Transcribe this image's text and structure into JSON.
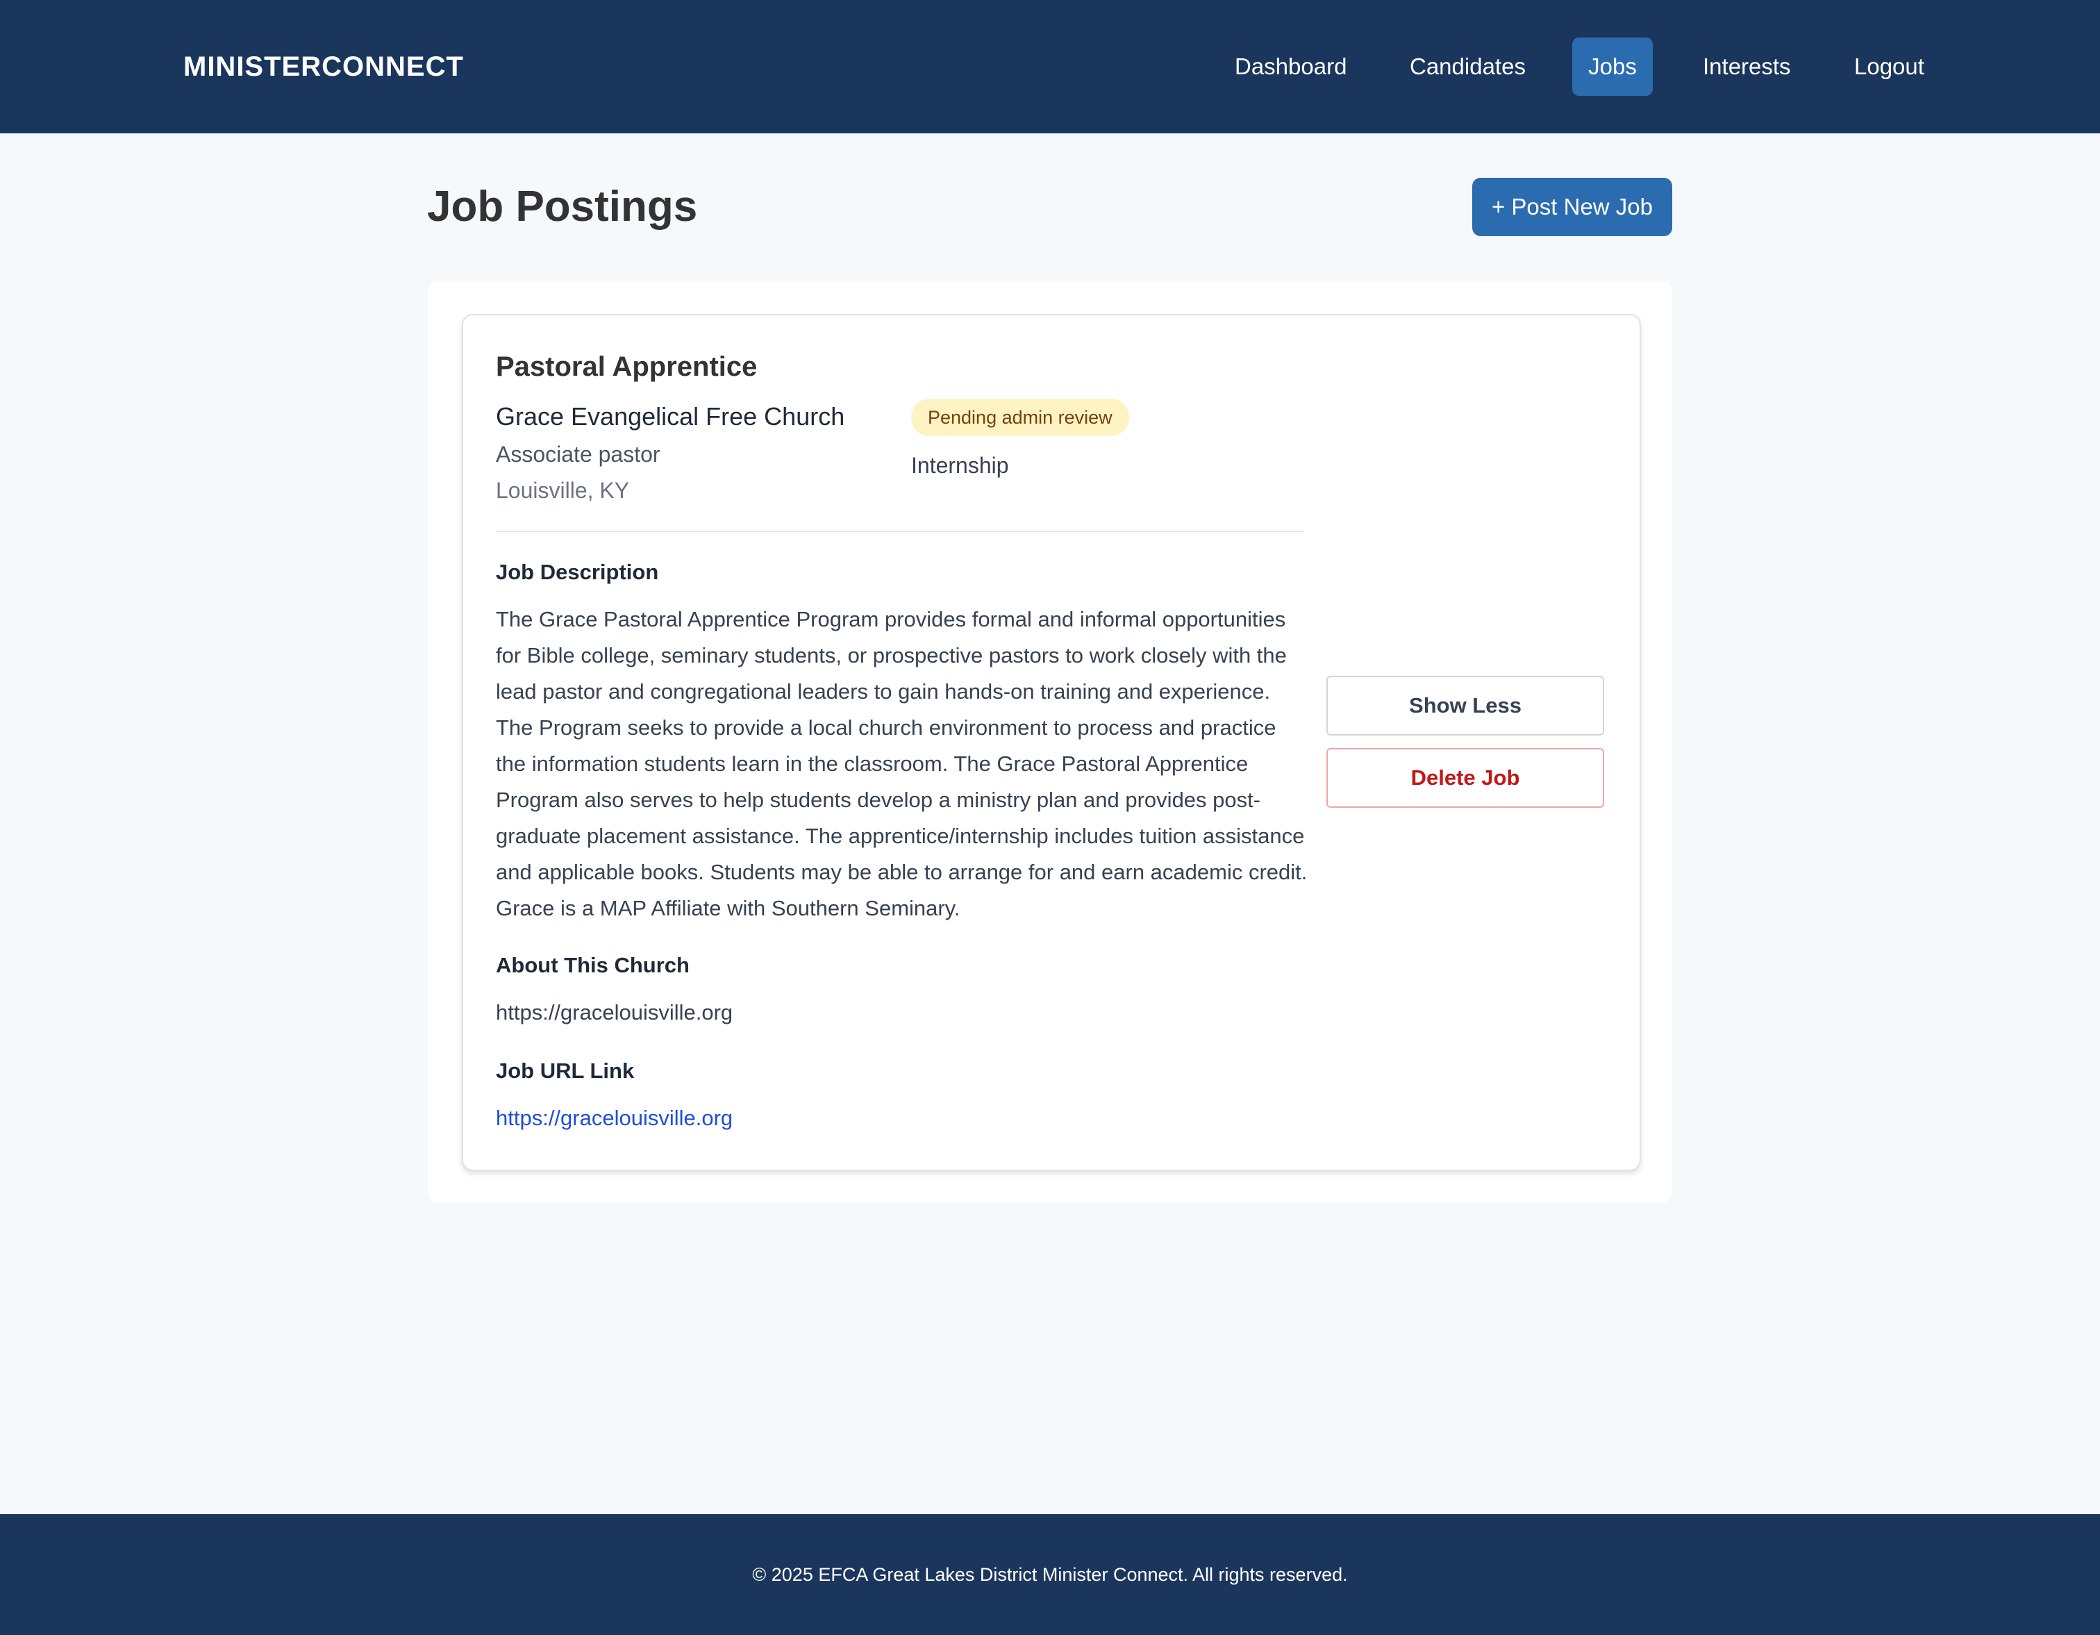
{
  "header": {
    "brand": "MINISTERCONNECT",
    "nav": [
      {
        "label": "Dashboard",
        "active": false
      },
      {
        "label": "Candidates",
        "active": false
      },
      {
        "label": "Jobs",
        "active": true
      },
      {
        "label": "Interests",
        "active": false
      },
      {
        "label": "Logout",
        "active": false
      }
    ]
  },
  "main": {
    "title": "Job Postings",
    "post_button_label": "+ Post New Job"
  },
  "job": {
    "title": "Pastoral Apprentice",
    "church": "Grace Evangelical Free Church",
    "position_type": "Associate pastor",
    "location": "Louisville, KY",
    "status": "Pending admin review",
    "job_type": "Internship",
    "description_heading": "Job Description",
    "description": "The Grace Pastoral Apprentice Program provides formal and informal opportunities for Bible college, seminary students, or prospective pastors to work closely with the lead pastor and congregational leaders to gain hands-on training and experience. The Program seeks to provide a local church environment to process and practice the information students learn in the classroom. The Grace Pastoral Apprentice Program also serves to help students develop a ministry plan and provides post-graduate placement assistance. The apprentice/internship includes tuition assistance and applicable books. Students may be able to arrange for and earn academic credit. Grace is a MAP Affiliate with Southern Seminary.",
    "about_heading": "About This Church",
    "about_text": "https://gracelouisville.org",
    "url_heading": "Job URL Link",
    "url": "https://gracelouisville.org",
    "show_less_label": "Show Less",
    "delete_label": "Delete Job"
  },
  "footer": {
    "text": "© 2025 EFCA Great Lakes District Minister Connect. All rights reserved."
  },
  "colors": {
    "header_bg": "#1b365d",
    "accent": "#2b6cb0",
    "page_bg": "#f5f9fc",
    "badge_bg": "#fef3c2",
    "badge_text": "#744210",
    "danger": "#c01818",
    "link": "#1d4ed8"
  }
}
